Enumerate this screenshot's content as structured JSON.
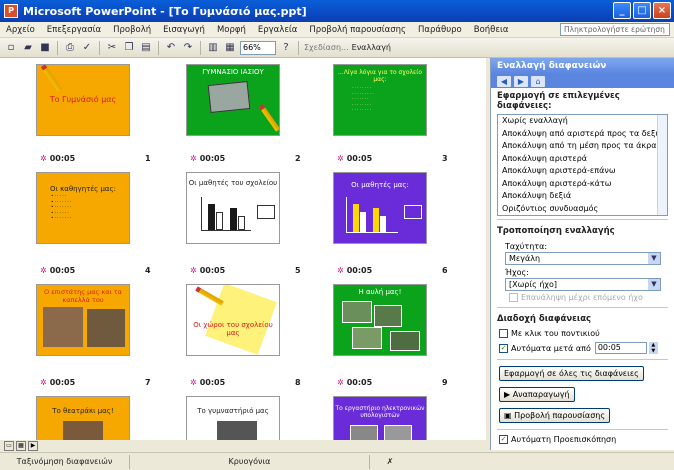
{
  "window": {
    "app_icon_text": "P",
    "title": "Microsoft PowerPoint - [Το Γυμνάσιό μας.ppt]"
  },
  "menu": {
    "items": [
      "Αρχείο",
      "Επεξεργασία",
      "Προβολή",
      "Εισαγωγή",
      "Μορφή",
      "Εργαλεία",
      "Προβολή παρουσίασης",
      "Παράθυρο",
      "Βοήθεια"
    ],
    "help_placeholder": "Πληκτρολογήστε ερώτηση"
  },
  "toolbar": {
    "zoom": "66%",
    "design_label": "Σχεδίαση...",
    "transition_label": "Εναλλαγή"
  },
  "slides": [
    {
      "num": "1",
      "time": "00:05",
      "title": "Το Γυμνάσιό μας",
      "bg": "#f7a800",
      "title_color": "#d81c1c"
    },
    {
      "num": "2",
      "time": "00:05",
      "title": "ΓΥΜΝΑΣΙΟ ΙΑΣΙΟΥ",
      "bg": "#0ba31b",
      "title_color": "#ffffff"
    },
    {
      "num": "3",
      "time": "00:05",
      "title": "...Λίγα λόγια για το σχολείο μας:",
      "bg": "#0ba31b",
      "title_color": "#ffff66"
    },
    {
      "num": "4",
      "time": "00:05",
      "title": "Οι καθηγητές μας:",
      "bg": "#f7a800",
      "title_color": "#222222"
    },
    {
      "num": "5",
      "time": "00:05",
      "title": "Οι μαθητές του σχολείου",
      "bg": "#ffffff",
      "title_color": "#222222"
    },
    {
      "num": "6",
      "time": "00:05",
      "title": "Οι μαθητές μας:",
      "bg": "#6a2bd9",
      "title_color": "#ffffff"
    },
    {
      "num": "7",
      "time": "00:05",
      "title": "Ο επιστάτης μας και τα καπελλά του",
      "bg": "#f7a800",
      "title_color": "#d81c1c"
    },
    {
      "num": "8",
      "time": "00:05",
      "title": "Οι χώροι του σχολείου μας",
      "bg": "#ffffff",
      "title_color": "#d81c1c"
    },
    {
      "num": "9",
      "time": "00:05",
      "title": "Η αυλή μας!",
      "bg": "#0ba31b",
      "title_color": "#ffffff"
    },
    {
      "title": "Το θεατράκι μας!",
      "bg": "#f7a800",
      "title_color": "#222222"
    },
    {
      "title": "Το γυμναστήριό μας",
      "bg": "#ffffff",
      "title_color": "#222222"
    },
    {
      "title": "Το εργαστήριο ηλεκτρονικών υπολογιστών",
      "bg": "#6a2bd9",
      "title_color": "#ffffff"
    }
  ],
  "taskpane": {
    "title": "Εναλλαγή διαφανειών",
    "apply_heading": "Εφαρμογή σε επιλεγμένες διαφάνειες:",
    "transitions": [
      "Χωρίς εναλλαγή",
      "Αποκάλυψη από αριστερά προς τα δεξιά",
      "Αποκάλυψη από τη μέση προς τα άκρα",
      "Αποκάλυψη αριστερά",
      "Αποκάλυψη αριστερά-επάνω",
      "Αποκάλυψη αριστερά-κάτω",
      "Αποκάλυψη δεξιά",
      "Οριζόντιος συνδυασμός"
    ],
    "modify_heading": "Τροποποίηση εναλλαγής",
    "speed_label": "Ταχύτητα:",
    "speed_value": "Μεγάλη",
    "sound_label": "Ήχος:",
    "sound_value": "[Χωρίς ήχο]",
    "loop_label": "Επανάληψη μέχρι επόμενο ήχο",
    "advance_heading": "Διαδοχή διαφάνειας",
    "on_click_label": "Με κλικ του ποντικιού",
    "auto_label": "Αυτόματα μετά από",
    "auto_value": "00:05",
    "apply_all_label": "Εφαρμογή σε όλες τις διαφάνειες",
    "play_label": "Αναπαραγωγή",
    "slideshow_label": "Προβολή παρουσίασης",
    "autopreview_label": "Αυτόματη Προεπισκόπηση"
  },
  "status": {
    "view": "Ταξινόμηση διαφανειών",
    "design": "Κρυογόνια"
  }
}
